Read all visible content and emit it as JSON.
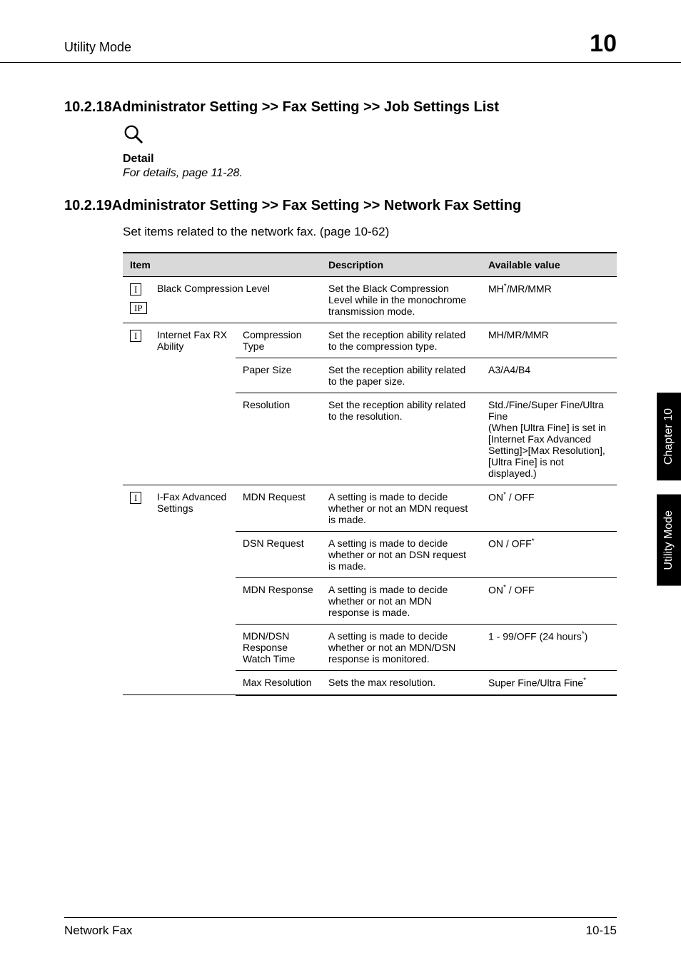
{
  "header": {
    "section": "Utility Mode",
    "chapter_num": "10"
  },
  "h_18": "10.2.18Administrator Setting >> Fax Setting >> Job Settings List",
  "detail": {
    "label": "Detail",
    "text": "For details, page 11-28."
  },
  "h_19": "10.2.19Administrator Setting >> Fax Setting >> Network Fax Setting",
  "intro": "Set items related to the network fax. (page 10-62)",
  "table": {
    "head": {
      "item": "Item",
      "desc": "Description",
      "val": "Available value"
    },
    "rows": [
      {
        "icons": [
          "I",
          "IP"
        ],
        "a": "Black Compression Level",
        "b": "",
        "desc": "Set the Black Compression Level while in the monochrome transmission mode.",
        "val_prefix": "MH",
        "val_sup": "*",
        "val_suffix": "/MR/MMR",
        "span_ab": true
      },
      {
        "icons": [
          "I"
        ],
        "a": "Internet Fax RX Ability",
        "b": "Compression Type",
        "desc": "Set the reception ability related to the compression type.",
        "val": "MH/MR/MMR",
        "group_start": true,
        "group_rows": 3
      },
      {
        "b": "Paper Size",
        "desc": "Set the reception ability related to the paper size.",
        "val": "A3/A4/B4"
      },
      {
        "b": "Resolution",
        "desc": "Set the reception ability related to the resolution.",
        "val": "Std./Fine/Super Fine/Ultra Fine\n(When [Ultra Fine] is set in [Internet Fax Advanced Setting]>[Max Resolution], [Ultra Fine] is not displayed.)"
      },
      {
        "icons": [
          "I"
        ],
        "a": "I-Fax Advanced Settings",
        "b": "MDN Request",
        "desc": "A setting is made to decide whether or not an MDN request is made.",
        "val_prefix": "ON",
        "val_sup": "*",
        "val_suffix": " / OFF",
        "group_start": true,
        "group_rows": 5
      },
      {
        "b": "DSN Request",
        "desc": "A setting is made to decide whether or not an DSN request is made.",
        "val_prefix": "ON / OFF",
        "val_sup": "*",
        "val_suffix": ""
      },
      {
        "b": "MDN Response",
        "desc": "A setting is made to decide whether or not an MDN response is made.",
        "val_prefix": "ON",
        "val_sup": "*",
        "val_suffix": " / OFF"
      },
      {
        "b": "MDN/DSN Response Watch Time",
        "desc": "A setting is made to decide whether or not an MDN/DSN response is monitored.",
        "val_prefix": "1 - 99/OFF (24 hours",
        "val_sup": "*",
        "val_suffix": ")"
      },
      {
        "b": "Max Resolution",
        "desc": "Sets the max resolution.",
        "val_prefix": "Super Fine/Ultra Fine",
        "val_sup": "*",
        "val_suffix": ""
      }
    ]
  },
  "side": {
    "tab1": "Chapter 10",
    "tab2": "Utility Mode"
  },
  "footer": {
    "left": "Network Fax",
    "right": "10-15"
  }
}
